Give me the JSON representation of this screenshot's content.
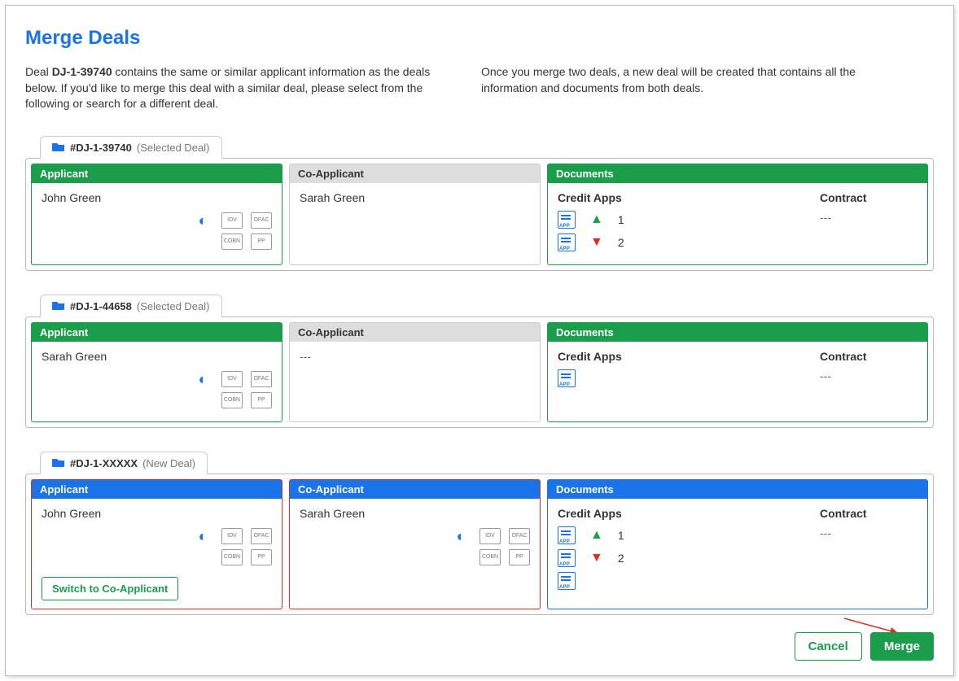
{
  "title": "Merge Deals",
  "intro": {
    "left_prefix": "Deal ",
    "deal_id_bold": "DJ-1-39740",
    "left_suffix": " contains the same or similar applicant information as the deals below. If you'd like to merge this deal with a similar deal, please select from the following or search for a different deal.",
    "right": "Once you merge two deals, a new deal will be created that contains all the information and documents from both deals."
  },
  "icons": {
    "idv": "IDV",
    "ofac": "OFAC",
    "cobn": "COBN",
    "pp": "PP"
  },
  "deals": [
    {
      "tab_id": "#DJ-1-39740",
      "tab_sub": "(Selected Deal)",
      "theme": "green",
      "applicant": {
        "header": "Applicant",
        "name": "John Green",
        "show_icons": true
      },
      "coapplicant": {
        "header": "Co-Applicant",
        "name": "Sarah Green",
        "grey": true,
        "show_icons": false
      },
      "documents": {
        "header": "Documents",
        "credit_label": "Credit Apps",
        "contract_label": "Contract",
        "contract_value": "---",
        "rows": [
          {
            "arrow": "up",
            "count": "1"
          },
          {
            "arrow": "down",
            "count": "2"
          }
        ]
      }
    },
    {
      "tab_id": "#DJ-1-44658",
      "tab_sub": "(Selected Deal)",
      "theme": "green",
      "applicant": {
        "header": "Applicant",
        "name": "Sarah Green",
        "show_icons": true
      },
      "coapplicant": {
        "header": "Co-Applicant",
        "name": "---",
        "grey": true,
        "show_icons": false
      },
      "documents": {
        "header": "Documents",
        "credit_label": "Credit Apps",
        "contract_label": "Contract",
        "contract_value": "---",
        "rows": [
          {
            "arrow": "none",
            "count": ""
          }
        ]
      }
    },
    {
      "tab_id": "#DJ-1-XXXXX",
      "tab_sub": "(New Deal)",
      "theme": "blue",
      "applicant": {
        "header": "Applicant",
        "name": "John Green",
        "show_icons": true,
        "switch_label": "Switch to Co-Applicant",
        "red_border": true
      },
      "coapplicant": {
        "header": "Co-Applicant",
        "name": "Sarah Green",
        "show_icons": true,
        "red_border": true
      },
      "documents": {
        "header": "Documents",
        "credit_label": "Credit Apps",
        "contract_label": "Contract",
        "contract_value": "---",
        "rows": [
          {
            "arrow": "up",
            "count": "1"
          },
          {
            "arrow": "down",
            "count": "2"
          },
          {
            "arrow": "none",
            "count": ""
          }
        ]
      }
    }
  ],
  "footer": {
    "cancel": "Cancel",
    "merge": "Merge"
  }
}
